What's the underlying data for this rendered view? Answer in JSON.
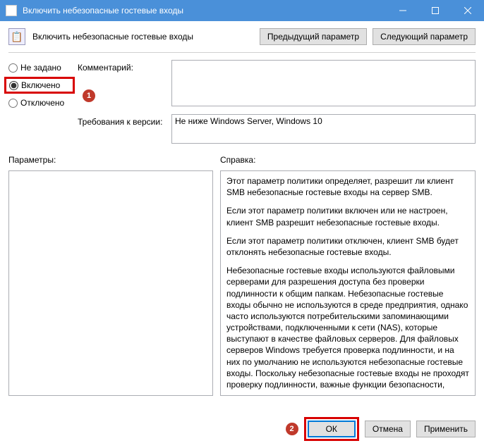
{
  "titlebar": {
    "title": "Включить небезопасные гостевые входы"
  },
  "header": {
    "title": "Включить небезопасные гостевые входы",
    "prev": "Предыдущий параметр",
    "next": "Следующий параметр"
  },
  "radios": {
    "not_configured": "Не задано",
    "enabled": "Включено",
    "disabled": "Отключено"
  },
  "comment": {
    "label": "Комментарий:",
    "value": ""
  },
  "supported": {
    "label": "Требования к версии:",
    "value": "Не ниже Windows Server, Windows 10"
  },
  "options": {
    "label": "Параметры:"
  },
  "help": {
    "label": "Справка:",
    "p1": "Этот параметр политики определяет, разрешит ли клиент SMB небезопасные гостевые входы на сервер SMB.",
    "p2": "Если этот параметр политики включен или не настроен, клиент SMB разрешит небезопасные гостевые входы.",
    "p3": "Если этот параметр политики отключен, клиент SMB будет отклонять небезопасные гостевые входы.",
    "p4": "Небезопасные гостевые входы используются файловыми серверами для разрешения доступа без проверки подлинности к общим папкам. Небезопасные гостевые входы обычно не используются в среде предприятия, однако часто используются потребительскими запоминающими устройствами, подключенными к сети (NAS), которые выступают в качестве файловых серверов. Для файловых серверов Windows требуется проверка подлинности, и на них по умолчанию не используются небезопасные гостевые входы. Поскольку небезопасные гостевые входы не проходят проверку подлинности, важные функции безопасности,"
  },
  "callouts": {
    "one": "1",
    "two": "2"
  },
  "buttons": {
    "ok": "ОК",
    "cancel": "Отмена",
    "apply": "Применить"
  }
}
